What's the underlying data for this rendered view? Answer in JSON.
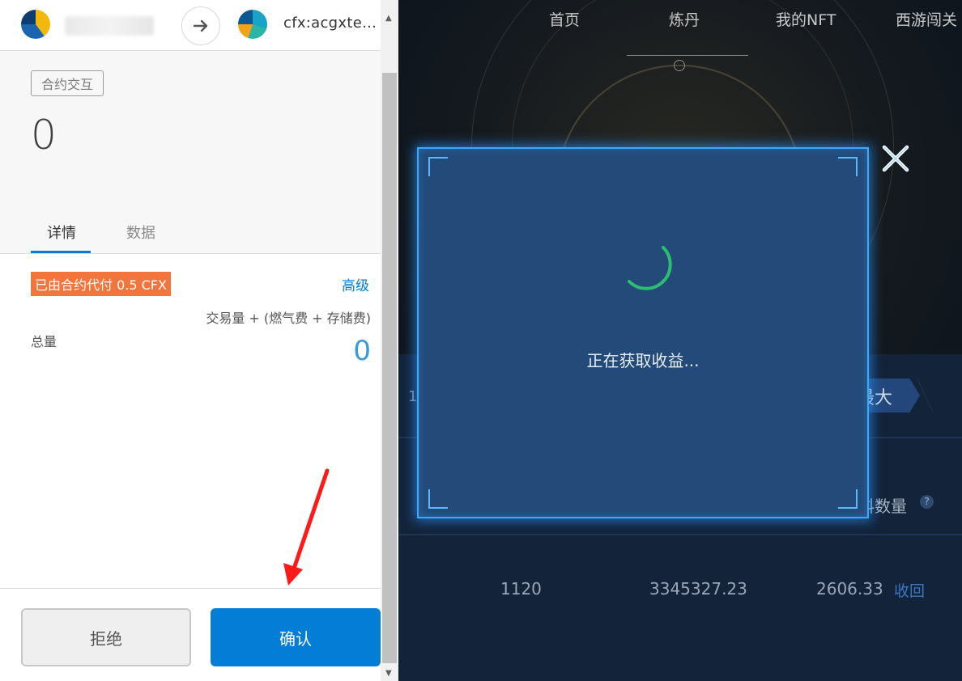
{
  "wallet": {
    "destination": "cfx:acgxte...",
    "tag": "合约交互",
    "amount": "0",
    "tabs": [
      "详情",
      "数据"
    ],
    "sponsor_badge": "已由合约代付 0.5 CFX",
    "advanced_label": "高级",
    "fee_label": "交易量 + (燃气费 + 存储费)",
    "total_label": "总量",
    "total_value": "0",
    "reject_label": "拒绝",
    "confirm_label": "确认"
  },
  "game": {
    "nav": [
      "首页",
      "炼丹",
      "我的NFT",
      "西游闯关"
    ],
    "modal_text": "正在获取收益...",
    "max_label": "最大",
    "left_number": "1",
    "column_header": "料数量",
    "help_symbol": "?",
    "row_values": [
      "1120",
      "3345327.23",
      "2606.33"
    ],
    "reclaim_label": "收回"
  },
  "colors": {
    "wallet_accent": "#037dd6",
    "sponsor_orange": "#f1753d",
    "modal_bg": "#234a78",
    "modal_glow": "#3ea8ff",
    "annotation_arrow": "#ff1a1a"
  },
  "icons": [
    "arrow-right-icon",
    "close-icon",
    "spinner-icon",
    "help-icon"
  ]
}
